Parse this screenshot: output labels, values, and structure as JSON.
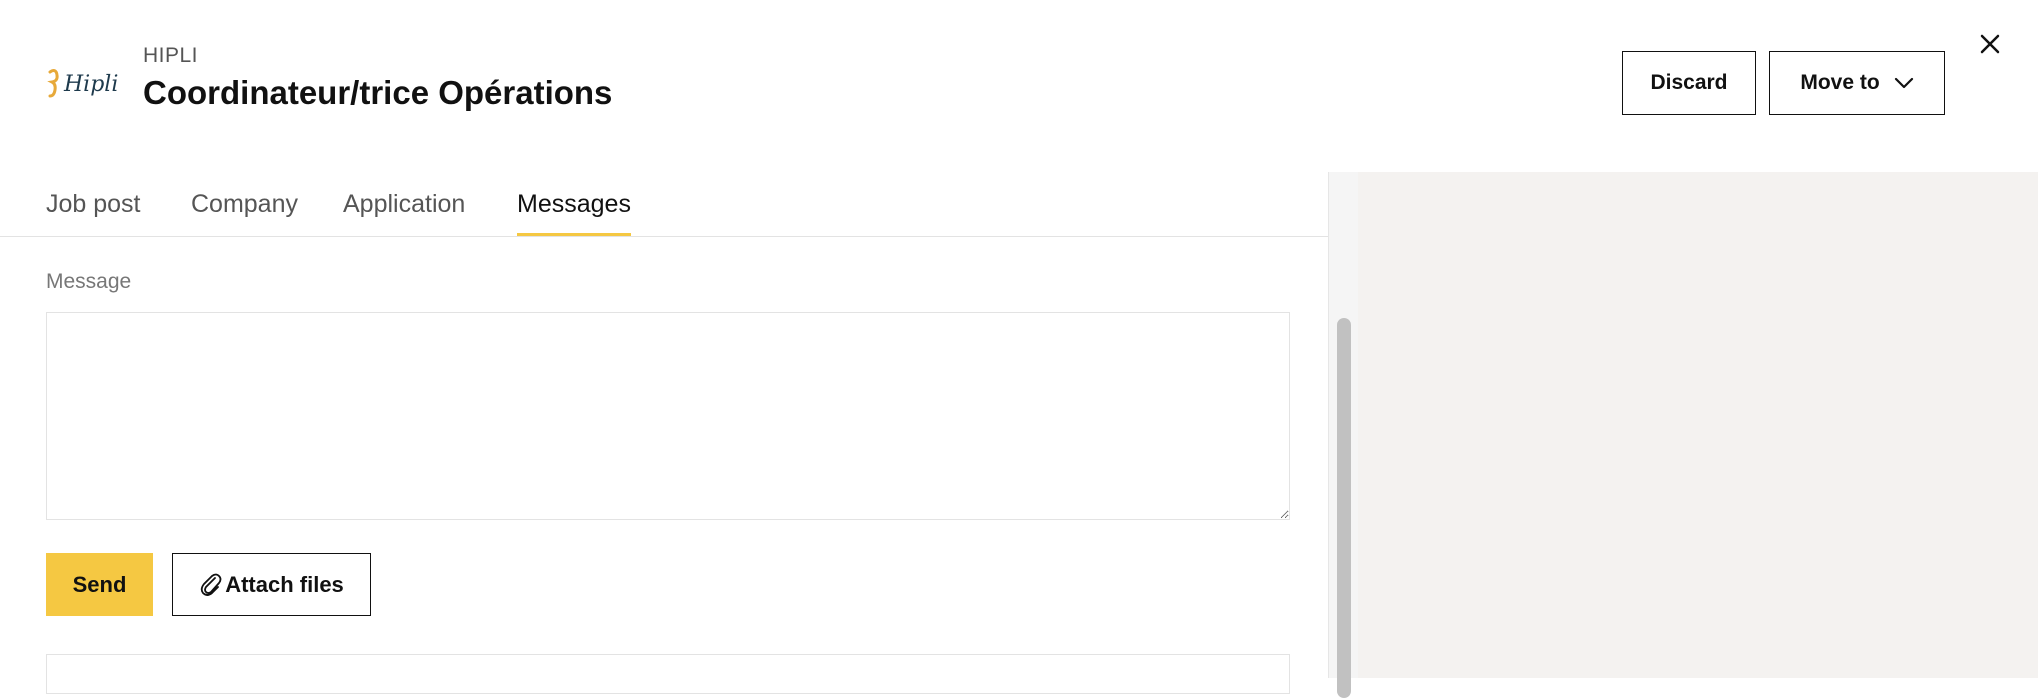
{
  "brand": {
    "logo_text": "Hipli",
    "accent": "#f5c842",
    "logo_color": "#1e3a4c"
  },
  "header": {
    "company": "HIPLI",
    "job_title": "Coordinateur/trice Opérations",
    "discard_label": "Discard",
    "move_to_label": "Move to",
    "close_icon": "close-icon"
  },
  "tabs": [
    {
      "label": "Job post",
      "active": false
    },
    {
      "label": "Company",
      "active": false
    },
    {
      "label": "Application",
      "active": false
    },
    {
      "label": "Messages",
      "active": true
    }
  ],
  "message": {
    "label": "Message",
    "value": "",
    "placeholder": ""
  },
  "actions": {
    "send_label": "Send",
    "attach_label": "Attach files",
    "attach_icon": "paperclip-icon"
  }
}
